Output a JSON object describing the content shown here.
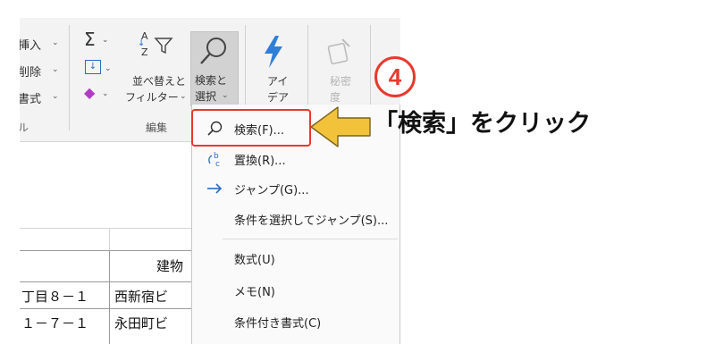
{
  "ribbon": {
    "partial_labels": [
      "挿入",
      "削除",
      "書式",
      "セル"
    ],
    "edit_group": {
      "sort_filter_line1": "並べ替えと",
      "sort_filter_line2": "フィルター",
      "find_select_line1": "検索と",
      "find_select_line2": "選択",
      "group_label": "編集"
    },
    "ideas_group": {
      "line1": "アイ",
      "line2": "デア"
    },
    "sensitivity_group": {
      "line1": "秘密",
      "line2": "度"
    }
  },
  "sheet": {
    "header_text": "建物",
    "rows": [
      {
        "address": "丁目８－１",
        "building": "西新宿ビ"
      },
      {
        "address": "１－７－１",
        "building": "永田町ビ"
      }
    ]
  },
  "menu": {
    "items": [
      {
        "label": "検索(F)...",
        "icon": "search-icon"
      },
      {
        "label": "置換(R)...",
        "icon": "replace-icon"
      },
      {
        "label": "ジャンプ(G)...",
        "icon": "arrow-right-icon"
      },
      {
        "label": "条件を選択してジャンプ(S)...",
        "icon": ""
      },
      {
        "label": "数式(U)",
        "icon": ""
      },
      {
        "label": "メモ(N)",
        "icon": ""
      },
      {
        "label": "条件付き書式(C)",
        "icon": ""
      }
    ]
  },
  "annotation": {
    "step_number": "4",
    "callout": "「検索」をクリック"
  },
  "colors": {
    "highlight_red": "#e8392d",
    "arrow_yellow": "#f2c33a",
    "accent_blue": "#2b6cc4",
    "ideas_blue": "#2f7fd8"
  }
}
